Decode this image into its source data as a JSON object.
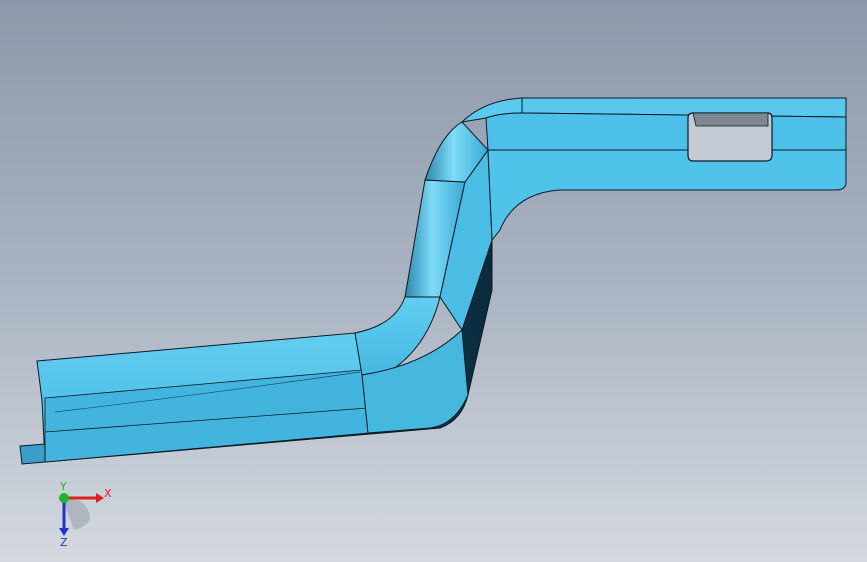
{
  "viewport": {
    "background_top": "#8d99aa",
    "background_bottom": "#d4d9e0"
  },
  "part": {
    "face_color": "#4fc3e8",
    "face_light": "#6fd5f5",
    "face_dark": "#2e8eb4",
    "edge_color": "#0a1a24"
  },
  "triad": {
    "x_label": "X",
    "y_label": "Y",
    "z_label": "Z",
    "x_color": "#e0201c",
    "y_color": "#1fb52a",
    "z_color": "#2233cc"
  }
}
